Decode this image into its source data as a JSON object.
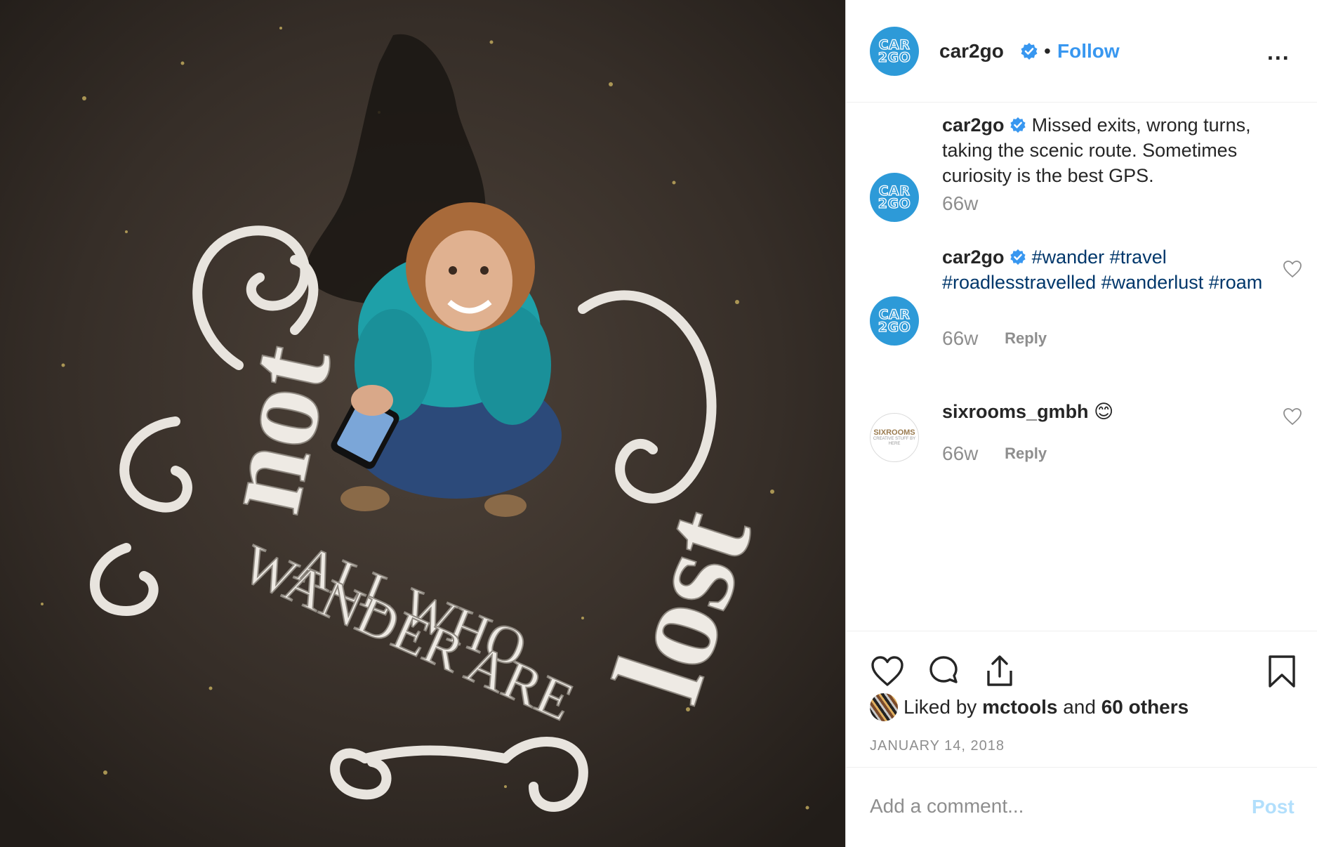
{
  "post": {
    "photo_text_lines": [
      "not",
      "ALL WHO",
      "WANDER ARE",
      "lost"
    ]
  },
  "header": {
    "username": "car2go",
    "avatar_logo_line1": "CAR",
    "avatar_logo_line2": "2GO",
    "separator": "•",
    "follow_label": "Follow",
    "more_label": "...",
    "icons": [
      "verified-badge-icon",
      "more-options-icon"
    ]
  },
  "comments": [
    {
      "username": "car2go",
      "text": "Missed exits, wrong turns, taking the scenic route. Sometimes curiosity is the best GPS.",
      "time": "66w"
    },
    {
      "username": "car2go",
      "tags": [
        "#wander",
        "#travel",
        "#roadlesstravelled",
        "#wanderlust",
        "#roam"
      ],
      "time": "66w",
      "reply_label": "Reply"
    },
    {
      "username": "sixrooms_gmbh",
      "avatar_title": "SIXROOMS",
      "avatar_sub": "CREATIVE STUFF BY HERE",
      "text": "😊",
      "time": "66w",
      "reply_label": "Reply"
    }
  ],
  "actions": {
    "icons": [
      "heart-icon",
      "comment-icon",
      "share-icon",
      "bookmark-icon"
    ],
    "liked_prefix": "Liked by",
    "liked_user": "mctools",
    "liked_and": "and",
    "liked_others": "60 others",
    "date": "JANUARY 14, 2018"
  },
  "composer": {
    "placeholder": "Add a comment...",
    "post_label": "Post"
  },
  "colors": {
    "link_blue": "#3897f0",
    "hashtag": "#00376b",
    "muted": "#8e8e8e",
    "post_disabled": "#b2dffc",
    "brand_avatar": "#2d9ad8"
  }
}
